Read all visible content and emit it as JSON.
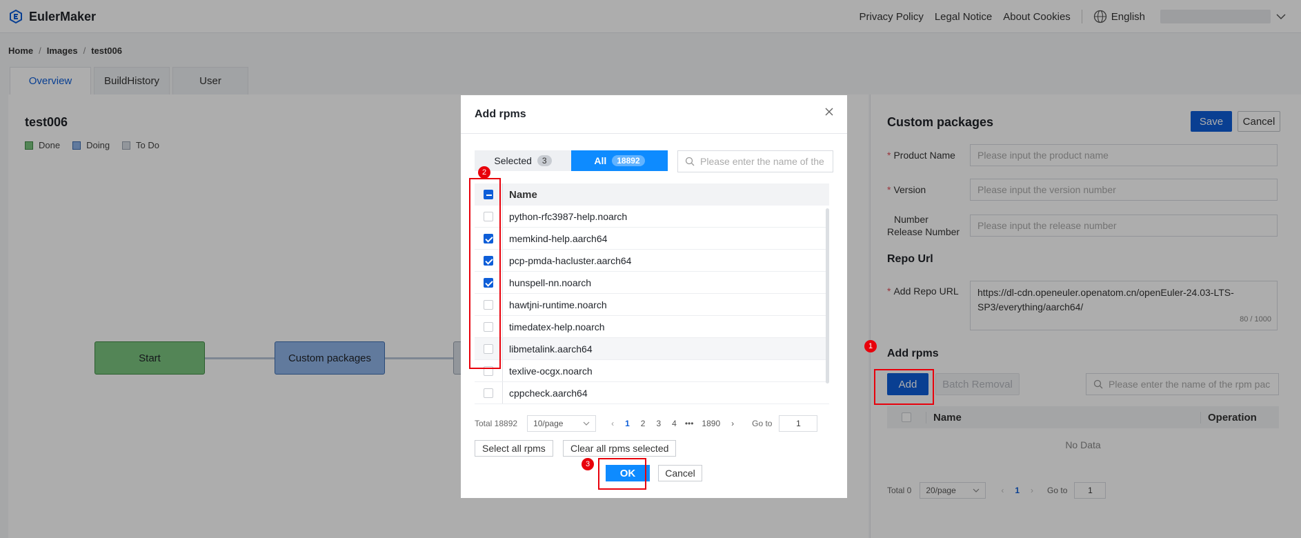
{
  "app": {
    "name": "EulerMaker"
  },
  "topnav": {
    "links": [
      "Privacy Policy",
      "Legal Notice",
      "About Cookies"
    ],
    "language": "English"
  },
  "breadcrumb": [
    "Home",
    "Images",
    "test006"
  ],
  "tabs": [
    "Overview",
    "BuildHistory",
    "User"
  ],
  "left": {
    "title": "test006",
    "legend": [
      {
        "label": "Done",
        "color": "#7bc47f"
      },
      {
        "label": "Doing",
        "color": "#8fb4e8"
      },
      {
        "label": "To Do",
        "color": "#d8dde5"
      }
    ],
    "nodes": [
      "Start",
      "Custom packages"
    ]
  },
  "right": {
    "title": "Custom packages",
    "save_label": "Save",
    "cancel_label": "Cancel",
    "product_name_label": "Product Name",
    "product_name_placeholder": "Please input the product name",
    "version_label": "Version",
    "version_placeholder": "Please input the version number",
    "release_label_line1": "Number",
    "release_label_line2": "Release Number",
    "release_placeholder": "Please input the release number",
    "repo_section": "Repo Url",
    "add_repo_label": "Add Repo URL",
    "repo_value": "https://dl-cdn.openeuler.openatom.cn/openEuler-24.03-LTS-SP3/everything/aarch64/",
    "repo_count": "80 / 1000",
    "rpms_section": "Add rpms",
    "add_label": "Add",
    "batch_removal_label": "Batch Removal",
    "search_placeholder": "Please enter the name of the rpm pac",
    "col_name": "Name",
    "col_operation": "Operation",
    "no_data": "No Data",
    "pager": {
      "total": "Total 0",
      "page_size": "20/page",
      "current": "1",
      "goto_label": "Go to",
      "goto_value": "1"
    }
  },
  "modal": {
    "title": "Add rpms",
    "selected_label": "Selected",
    "selected_count": "3",
    "all_label": "All",
    "all_count": "18892",
    "search_placeholder": "Please enter the name of the",
    "col_name": "Name",
    "rows": [
      {
        "name": "python-rfc3987-help.noarch",
        "checked": false
      },
      {
        "name": "memkind-help.aarch64",
        "checked": true
      },
      {
        "name": "pcp-pmda-hacluster.aarch64",
        "checked": true
      },
      {
        "name": "hunspell-nn.noarch",
        "checked": true
      },
      {
        "name": "hawtjni-runtime.noarch",
        "checked": false
      },
      {
        "name": "timedatex-help.noarch",
        "checked": false
      },
      {
        "name": "libmetalink.aarch64",
        "checked": false
      },
      {
        "name": "texlive-ocgx.noarch",
        "checked": false
      },
      {
        "name": "cppcheck.aarch64",
        "checked": false
      }
    ],
    "pager": {
      "total": "Total 18892",
      "page_size": "10/page",
      "pages": [
        "1",
        "2",
        "3",
        "4",
        "•••",
        "1890"
      ],
      "goto_label": "Go to",
      "goto_value": "1"
    },
    "select_all_label": "Select all rpms",
    "clear_all_label": "Clear all rpms selected",
    "ok_label": "OK",
    "cancel_label": "Cancel"
  },
  "annotations": [
    "1",
    "2",
    "3"
  ],
  "colors": {
    "accent": "#0e5ed8",
    "annotation": "#e8000b"
  }
}
